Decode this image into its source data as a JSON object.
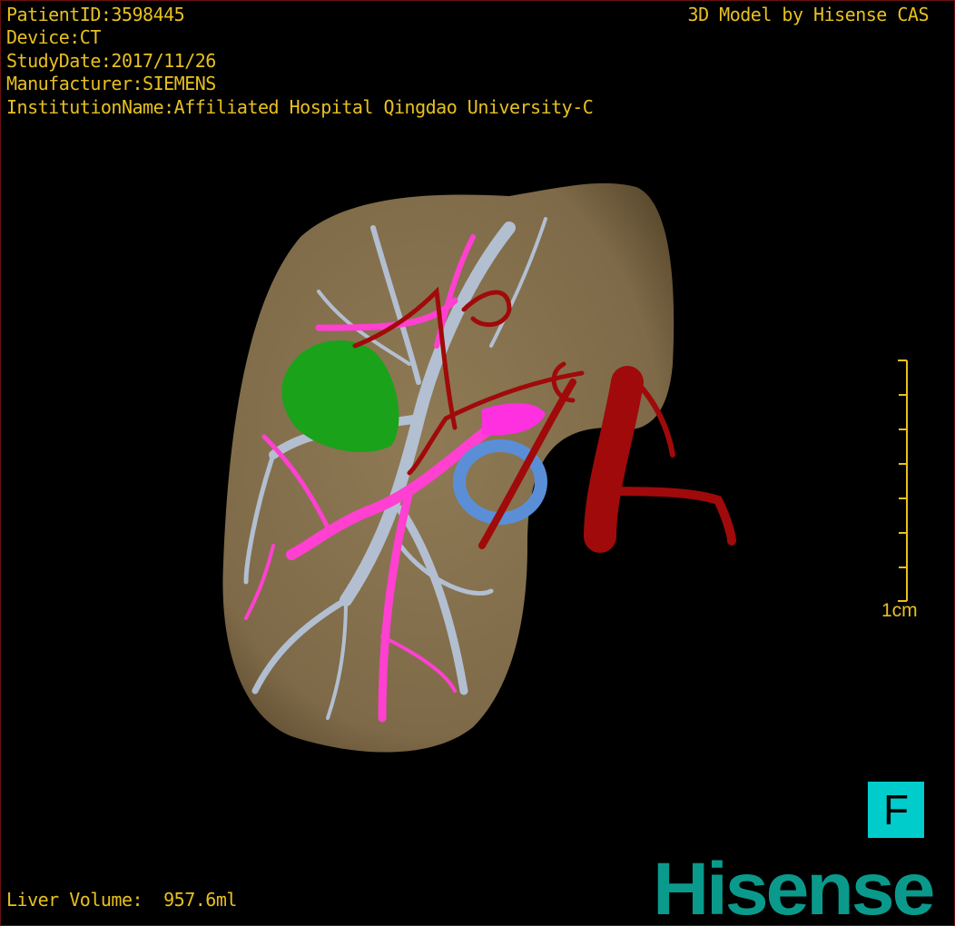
{
  "overlay": {
    "patient_id": "PatientID:3598445",
    "device": "Device:CT",
    "study_date": "StudyDate:2017/11/26",
    "manufacturer": "Manufacturer:SIEMENS",
    "institution": "InstitutionName:Affiliated Hospital Qingdao University-C",
    "brand": "3D Model by Hisense CAS",
    "liver_volume": "Liver Volume:  957.6ml"
  },
  "scale_bar": {
    "label": "1cm",
    "ticks": 8
  },
  "orientation_button": {
    "label": "F"
  },
  "logo": "Hisense",
  "colors": {
    "text": "#e8c020",
    "liver": "#8a7550",
    "portal_vein": "#b8c8e0",
    "hepatic_vein": "#ff40d0",
    "artery": "#a00a0a",
    "tumor": "#1aa21a",
    "gallbladder_duct": "#5a8fd8",
    "orientation": "#00cccc",
    "logo": "#0a9a8c"
  }
}
